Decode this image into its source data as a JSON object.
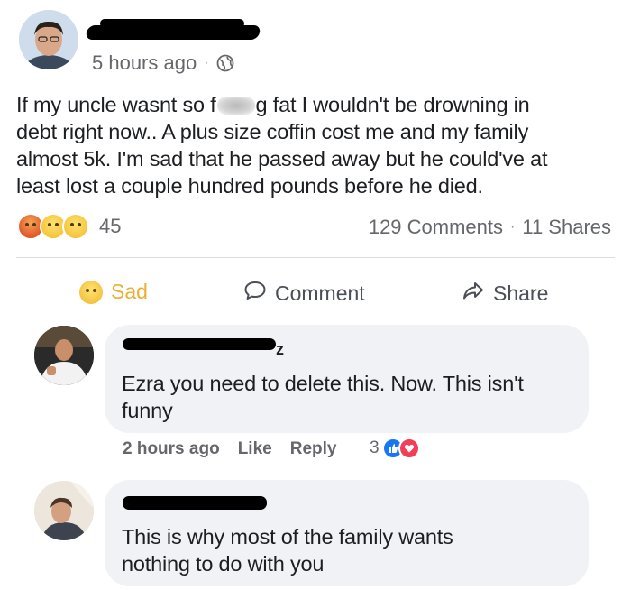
{
  "post": {
    "timestamp": "5 hours ago",
    "separator": "·",
    "text_lines": [
      "If my uncle wasnt so f",
      "g fat I wouldn't be drowning in",
      "debt right now.. A plus size coffin cost me and my family",
      "almost 5k. I'm sad that he passed away but he could've at",
      "least lost a couple hundred pounds before he died."
    ],
    "reaction_count": "45",
    "comments_count": "129 Comments",
    "shares_count": "11 Shares",
    "stats_separator": "·"
  },
  "actions": {
    "sad_label": "Sad",
    "comment_label": "Comment",
    "share_label": "Share"
  },
  "comments": [
    {
      "name_suffix": "z",
      "text_lines": [
        "Ezra you need to delete this. Now. This isn't",
        "funny"
      ],
      "timestamp": "2 hours ago",
      "like_label": "Like",
      "reply_label": "Reply",
      "reaction_count": "3"
    },
    {
      "text_lines": [
        "This is why most of the family wants",
        "nothing to do with you"
      ]
    }
  ],
  "colors": {
    "like_blue": "#1877f2",
    "love_red": "#f33e58",
    "sad_yellow": "#e9b034",
    "muted_text": "#65676b",
    "bubble_bg": "#f0f2f5"
  }
}
